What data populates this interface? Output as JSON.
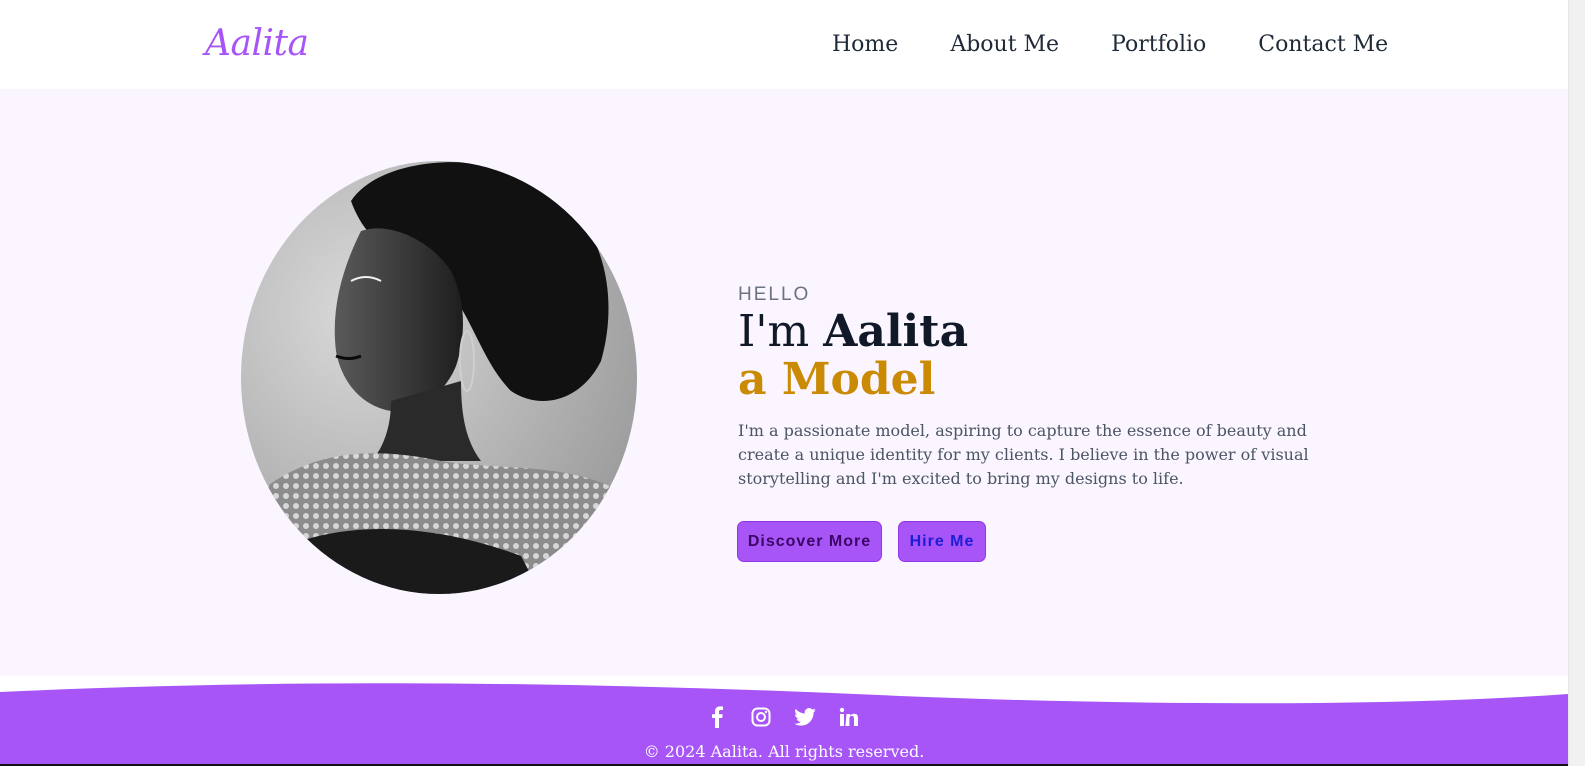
{
  "brand": {
    "logo": "Aalita",
    "accent": "#a855f7",
    "highlight": "#ca8a04"
  },
  "nav": {
    "items": [
      "Home",
      "About Me",
      "Portfolio",
      "Contact Me"
    ]
  },
  "hero": {
    "greeting": "HELLO",
    "intro": "I'm ",
    "name": "Aalita",
    "role": "a Model",
    "description": "I'm a passionate model, aspiring to capture the essence of beauty and create a unique identity for my clients. I believe in the power of visual storytelling and I'm excited to bring my designs to life.",
    "buttons": {
      "discover": "Discover More",
      "hire": "Hire Me"
    },
    "image": "portrait-photo"
  },
  "footer": {
    "social": [
      "facebook-icon",
      "instagram-icon",
      "twitter-icon",
      "linkedin-icon"
    ],
    "copyright": "© 2024 Aalita. All rights reserved."
  }
}
